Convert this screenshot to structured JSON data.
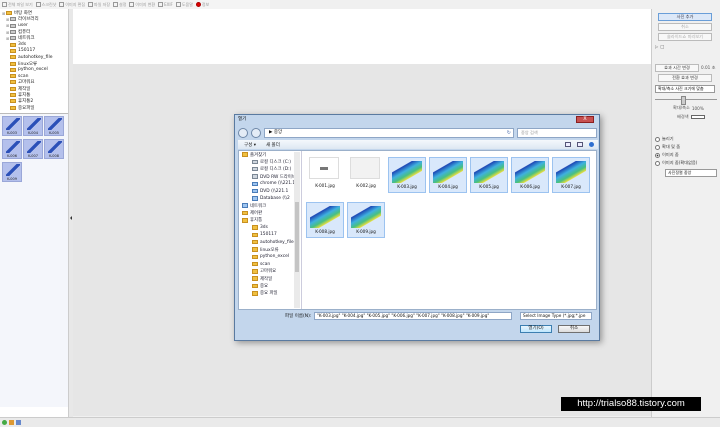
{
  "toolbar": {
    "items": [
      "전체 파일 보기",
      "스크린샷",
      "이미지 편집",
      "파일 저장",
      "설정",
      "이미지 변환",
      "EXIF",
      "도움말",
      "정보"
    ]
  },
  "tree": {
    "items": [
      "바탕 화면",
      "라이브러리",
      "user",
      "컴퓨터",
      "네트워크",
      "3ds",
      "150117",
      "autohotkey_file",
      "linux오류",
      "python_excel",
      "scan",
      "고마워요",
      "제작일",
      "휴지통",
      "휴지통2",
      "중요파일"
    ]
  },
  "thumbs": [
    "K-003",
    "K-004",
    "K-005",
    "K-006",
    "K-007",
    "K-008",
    "K-009"
  ],
  "right_panel": {
    "btn_main": "사진 추가",
    "btn_2": "취소",
    "btn_3": "슬라이드쇼 미리보기",
    "btn_4": "효과 시간 변경",
    "value_1": "0.01 초",
    "btn_5": "전환 효과 변경",
    "select_1": "확대/축소 사진 크기에 맞춤",
    "zoom_label": "확대/축소",
    "zoom_value": "100%",
    "bg_label": "배경색",
    "radios": [
      "늘리기",
      "확대 및 줌",
      "이미지 줌",
      "이미지 줌(확대없음)"
    ],
    "select_2": "사진정렬  중앙"
  },
  "dialog": {
    "title": "열기",
    "close": "X",
    "address": "▶ 중앙",
    "search_placeholder": "중앙 검색",
    "organize": "구성 ▾",
    "new_folder": "새 폴더",
    "nav": [
      {
        "label": "즐겨찾기",
        "lvl": 0,
        "icon": "fold"
      },
      {
        "label": "로컬 디스크 (C:)",
        "lvl": 1,
        "icon": "drive"
      },
      {
        "label": "로컬 디스크 (D:)",
        "lvl": 1,
        "icon": "drive"
      },
      {
        "label": "DVD RW 드라이브",
        "lvl": 1,
        "icon": "drive"
      },
      {
        "label": "chrome (\\\\221.1",
        "lvl": 1,
        "icon": "net"
      },
      {
        "label": "DVD (\\\\221.1",
        "lvl": 1,
        "icon": "net"
      },
      {
        "label": "Database (\\\\2",
        "lvl": 1,
        "icon": "net"
      },
      {
        "label": "네트워크",
        "lvl": 0,
        "icon": "net"
      },
      {
        "label": "제어판",
        "lvl": 0,
        "icon": "fold"
      },
      {
        "label": "휴지통",
        "lvl": 0,
        "icon": "fold"
      },
      {
        "label": "3ds",
        "lvl": 1,
        "icon": "fold"
      },
      {
        "label": "150117",
        "lvl": 1,
        "icon": "fold"
      },
      {
        "label": "autohotkey_file",
        "lvl": 1,
        "icon": "fold"
      },
      {
        "label": "linux오류",
        "lvl": 1,
        "icon": "fold"
      },
      {
        "label": "python_excel",
        "lvl": 1,
        "icon": "fold"
      },
      {
        "label": "scan",
        "lvl": 1,
        "icon": "fold"
      },
      {
        "label": "고마워요",
        "lvl": 1,
        "icon": "fold"
      },
      {
        "label": "제작일",
        "lvl": 1,
        "icon": "fold"
      },
      {
        "label": "중요",
        "lvl": 1,
        "icon": "fold"
      },
      {
        "label": "중요 파일",
        "lvl": 1,
        "icon": "fold"
      }
    ],
    "files": [
      {
        "name": "K-001.jpg",
        "kind": "blank",
        "selected": false
      },
      {
        "name": "K-002.jpg",
        "kind": "blank2",
        "selected": false
      },
      {
        "name": "K-003.jpg",
        "kind": "model",
        "selected": true
      },
      {
        "name": "K-004.jpg",
        "kind": "model",
        "selected": true
      },
      {
        "name": "K-005.jpg",
        "kind": "model",
        "selected": true
      },
      {
        "name": "K-006.jpg",
        "kind": "model",
        "selected": true
      },
      {
        "name": "K-007.jpg",
        "kind": "model",
        "selected": true
      },
      {
        "name": "K-008.jpg",
        "kind": "model",
        "selected": true
      },
      {
        "name": "K-009.jpg",
        "kind": "model",
        "selected": true
      }
    ],
    "filename_label": "파일 이름(N):",
    "filename_value": "\"K-003.jpg\" \"K-004.jpg\" \"K-005.jpg\" \"K-006.jpg\" \"K-007.jpg\" \"K-008.jpg\" \"K-009.jpg\"",
    "filetype": "Select Image Type (*.jpg;*.jpe",
    "open_btn": "열기(O)",
    "cancel_btn": "취소"
  },
  "watermark": "http://trialso88.tistory.com"
}
